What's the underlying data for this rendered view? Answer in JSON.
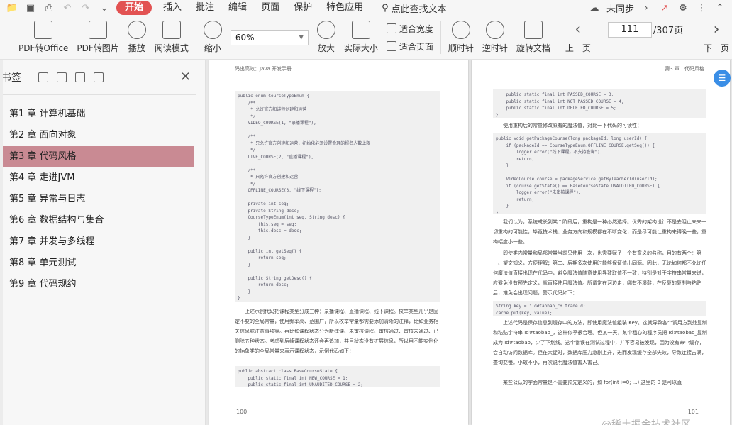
{
  "menubar": {
    "items": [
      "开始",
      "插入",
      "批注",
      "编辑",
      "页面",
      "保护",
      "特色应用"
    ],
    "search": "点此查找文本",
    "sync": "未同步"
  },
  "ribbon": {
    "pdf_to_office": "PDF转Office",
    "pdf_to_image": "PDF转图片",
    "play": "播放",
    "read_mode": "阅读模式",
    "zoom_out": "缩小",
    "zoom_value": "60%",
    "zoom_in": "放大",
    "actual_size": "实际大小",
    "fit_width": "适合宽度",
    "fit_page": "适合页面",
    "rotate_cw": "顺时针",
    "rotate_ccw": "逆时针",
    "rotate_doc": "旋转文档",
    "prev_page": "上一页",
    "current_page": "111",
    "total_pages": "/307页",
    "next_page": "下一页"
  },
  "sidebar": {
    "title": "书签",
    "bookmarks": [
      "第1 章 计算机基础",
      "第2 章 面向对象",
      "第3 章 代码风格",
      "第4 章 走进JVM",
      "第5 章 异常与日志",
      "第6 章 数据结构与集合",
      "第7 章 并发与多线程",
      "第8 章 单元测试",
      "第9 章 代码规约"
    ],
    "selected_index": 2
  },
  "document": {
    "left_header": "码出高效：Java 开发手册",
    "left_page_number": "100",
    "right_header": "第3 章　代码风格",
    "right_page_number": "101",
    "left_code_1": "public enum CourseTypeEnum {\n    /**\n     * 允许官方和讲师创建和运营\n     */\n    VIDEO_COURSE(1, \"录播课程\"),\n\n    /**\n     * 只允许官方创建和运营，初始化必须设置合理的报名人数上限\n     */\n    LIVE_COURSE(2, \"直播课程\"),\n\n    /**\n     * 只允许官方创建和运营\n     */\n    OFFLINE_COURSE(3, \"线下课程\");\n\n    private int seq;\n    private String desc;\n    CourseTypeEnum(int seq, String desc) {\n        this.seq = seq;\n        this.desc = desc;\n    }\n\n    public int getSeq() {\n        return seq;\n    }\n\n    public String getDesc() {\n        return desc;\n    }\n}",
    "left_para": "上述示例代码把课程类型分成三种：录播课程、直播课程、线下课程。枚举类型几乎是固定不变的全局常量，使用频率高、范围广，所以枚举常量都需要添加清晰的注释，比如业务相关信息或注意事项等。再比如课程状态分为新建课、未审核课程、审核通过、审核未通过、已删除五种状态。考虑到后续课程状态还会再追加，并且状态没有扩展信息，所以用不能实例化的抽象类的全局常量来表示课程状态，示例代码如下：",
    "left_code_2": "public abstract class BaseCourseState {\n    public static final int NEW_COURSE = 1;\n    public static final int UNAUDITED_COURSE = 2;",
    "right_code_1": "    public static final int PASSED_COURSE = 3;\n    public static final int NOT_PASSED_COURSE = 4;\n    public static final int DELETED_COURSE = 5;\n}",
    "right_para_1": "使用重构后的常量修改原有的魔法值，对比一下代码的可读性：",
    "right_code_2": "public void getPackageCourse(long packageId, long userId) {\n    if (packageId == CourseTypeEnum.OFFLINE_COURSE.getSeq()) {\n        logger.error(\"线下课程，不支持查询\");\n        return;\n    }\n\n    VideoCourse course = packageService.getByTeacherId(userId);\n    if (course.getState() == BaseCourseState.UNAUDITED_COURSE) {\n        logger.error(\"未审核课程\");\n        return;\n    }\n}",
    "right_para_2": "我们认为，系统成长到某个阶段后，重构是一种必然选择。优秀的架构设计不是去阻止未来一切重构的可能性，毕竟技术栈、业务方向和规模都在不断变化，而是尽可能让重构来得晚一些，重构幅度小一些。",
    "right_para_3": "即使类内常量和局部常量当前只使用一次，也需要赋予一个有意义的名称，目的有两个：第一、望文知义，方便理解；第二、后期多次使用时能够保证值出同源。因此，无论如何都不允许任何魔法值直接出现在代码中，避免魔法值随意使用导致取值不一致，特别是对于字符串常量来说，应避免没有预先定义，就直接使用魔法值。所谓常在河边走，哪有不湿鞋，在反复的复制与粘贴后，难免会出现问题，警示代码如下：",
    "right_code_3": "String key = \"Id#taobao_\"+ tradeId;\ncache.put(key, value);",
    "right_para_4": "上述代码是保存信息到缓存中的方法，即使用魔法值组装 Key。这就导致各个调用方到处复制和粘贴字符串 Id#taobao_，这样似乎很合理。但某一天，某个粗心的程序员把 Id#taobao_复制成为 Id#taobao，少了下划线。这个错误在测试过程中，并不容易被发现，因为没有命中缓存，会自动访问数据库。但在大促时，数据库压力急剧上升，进而发现缓存全部失效，导致连接占满，查询变慢。小故不小，再次说明魔法值害人害己。",
    "right_para_5": "某些公认的字面常量是不需要预先定义的，如 for(int i=0; ...) 这里的 0 是可以直"
  },
  "watermark": "@稀土掘金技术社区"
}
